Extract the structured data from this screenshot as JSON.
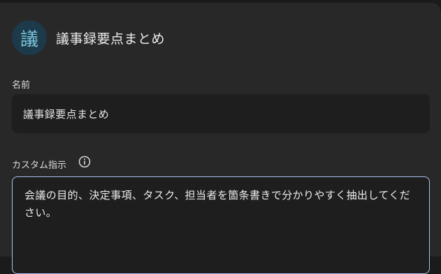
{
  "header": {
    "avatar_char": "議",
    "title": "議事録要点まとめ"
  },
  "name_section": {
    "label": "名前",
    "value": "議事録要点まとめ"
  },
  "instructions_section": {
    "label": "カスタム指示",
    "info_icon": "info-icon",
    "value": "会議の目的、決定事項、タスク、担当者を箇条書きで分かりやすく抽出してください。"
  },
  "colors": {
    "background": "#282828",
    "field": "#1e1e1f",
    "focus_border": "#a8c1ef",
    "avatar_bg": "#1c3a4a",
    "avatar_fg": "#7cc4dc"
  }
}
